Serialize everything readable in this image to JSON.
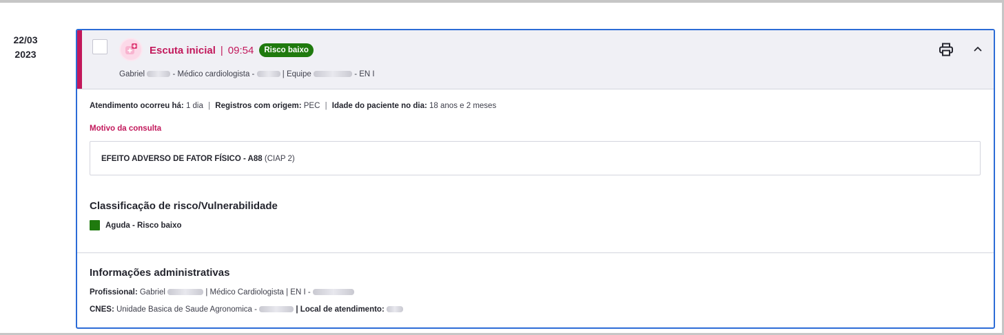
{
  "timeline": {
    "date_day": "22/03",
    "date_year": "2023"
  },
  "card": {
    "title": "Escuta inicial",
    "title_separator": "|",
    "time": "09:54",
    "risk_badge": "Risco baixo",
    "subtitle_professional": "Gabriel",
    "subtitle_specialty": "- Médico cardiologista -",
    "subtitle_team_label": "| Equipe",
    "subtitle_team_suffix": "- EN I",
    "icons": {
      "type": "consultation-icon",
      "print": "printer-icon",
      "collapse": "chevron-up-icon"
    },
    "accent_color": "#c2185b",
    "border_color": "#2b6bd6"
  },
  "details": {
    "atendimento_label": "Atendimento ocorreu há:",
    "atendimento_value": "1 dia",
    "registros_label": "Registros com origem:",
    "registros_value": "PEC",
    "idade_label": "Idade do paciente no dia:",
    "idade_value": "18 anos e 2 meses",
    "separator": "|"
  },
  "motivo": {
    "label": "Motivo da consulta",
    "diagnosis": "EFEITO ADVERSO DE FATOR FÍSICO - A88",
    "code_system": "(CIAP 2)"
  },
  "risk": {
    "title": "Classificação de risco/Vulnerabilidade",
    "value": "Aguda - Risco baixo",
    "color": "#1f7a0e"
  },
  "admin": {
    "title": "Informações administrativas",
    "profissional_label": "Profissional:",
    "profissional_value": "Gabriel",
    "profissional_role": "| Médico Cardiologista | EN I -",
    "cnes_label": "CNES:",
    "cnes_value": "Unidade Basica de Saude Agronomica -",
    "local_label": "| Local de atendimento:"
  }
}
